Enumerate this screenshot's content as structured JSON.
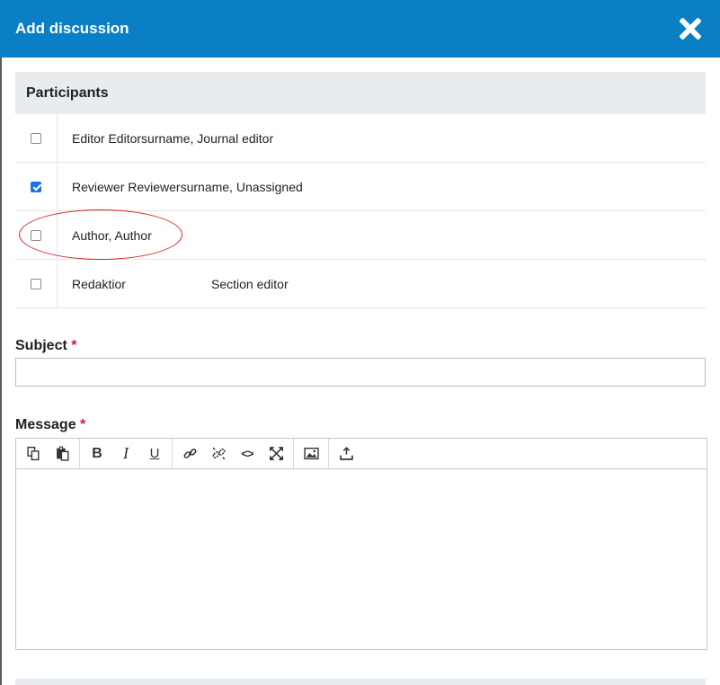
{
  "header": {
    "title": "Add discussion"
  },
  "participants": {
    "heading": "Participants",
    "rows": [
      {
        "name": "Editor Editorsurname, Journal editor",
        "role": "",
        "checked": false
      },
      {
        "name": "Reviewer Reviewersurname, Unassigned",
        "role": "",
        "checked": true
      },
      {
        "name": "Author, Author",
        "role": "",
        "checked": false
      },
      {
        "name": "Redaktior",
        "role": "Section editor",
        "checked": false
      }
    ]
  },
  "subject": {
    "label": "Subject",
    "required_mark": "*",
    "value": ""
  },
  "message": {
    "label": "Message",
    "required_mark": "*",
    "value": ""
  },
  "toolbar": {
    "icons": [
      "copy-icon",
      "paste-icon",
      "bold-icon",
      "italic-icon",
      "underline-icon",
      "link-icon",
      "unlink-icon",
      "code-icon",
      "fullscreen-icon",
      "image-icon",
      "upload-icon"
    ],
    "bold_glyph": "B",
    "italic_glyph": "I",
    "underline_glyph": "U",
    "code_glyph": "<>"
  },
  "colors": {
    "header": "#0a7fc3",
    "required": "#d0106a",
    "checkbox_checked": "#1a73e8",
    "annotation": "#d42020"
  }
}
